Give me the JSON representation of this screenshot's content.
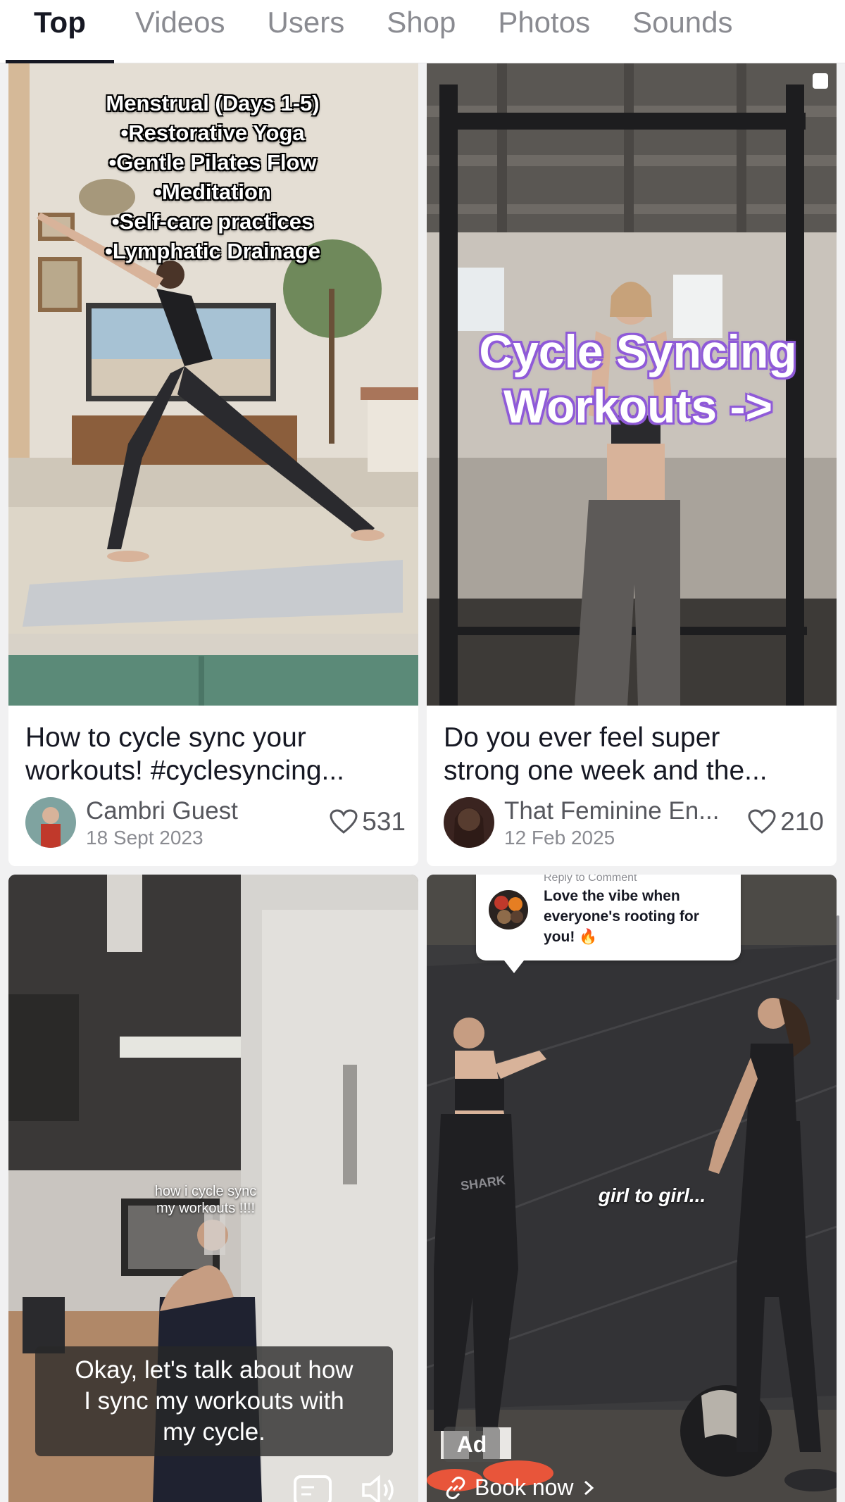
{
  "tabs": [
    {
      "label": "Top",
      "active": true
    },
    {
      "label": "Videos",
      "active": false
    },
    {
      "label": "Users",
      "active": false
    },
    {
      "label": "Shop",
      "active": false
    },
    {
      "label": "Photos",
      "active": false
    },
    {
      "label": "Sounds",
      "active": false
    }
  ],
  "cards": [
    {
      "overlay_lines": [
        "Menstrual (Days 1-5)",
        "•Restorative Yoga",
        "•Gentle Pilates Flow",
        "•Meditation",
        "•Self-care practices",
        "•Lymphatic Drainage"
      ],
      "caption_lines": [
        "How to cycle sync your",
        "workouts! #cyclesyncing..."
      ],
      "author": "Cambri Guest",
      "date": "18 Sept 2023",
      "likes": "531"
    },
    {
      "overlay_lines": [
        "Cycle Syncing",
        "Workouts ->"
      ],
      "caption_lines": [
        "Do you ever feel super",
        "strong one week and the..."
      ],
      "author": "That Feminine En...",
      "date": "12 Feb 2025",
      "likes": "210"
    },
    {
      "overlay_lines": [
        "how i cycle sync",
        "my workouts !!!!"
      ],
      "subtitle_lines": [
        "Okay, let's talk about how",
        "I sync my workouts with",
        "my cycle."
      ]
    },
    {
      "comment_header": "Reply to Comment",
      "comment_lines": [
        "Love the vibe when",
        "everyone's rooting for",
        "you! 🔥"
      ],
      "overlay_text": "girl to girl...",
      "ad_label": "Ad",
      "cta_label": "Book now",
      "wall_text": "SHARK"
    }
  ],
  "colors": {
    "accent_purple": "#8f5ad8",
    "text_primary": "#161823",
    "text_secondary": "#8a8b91"
  }
}
